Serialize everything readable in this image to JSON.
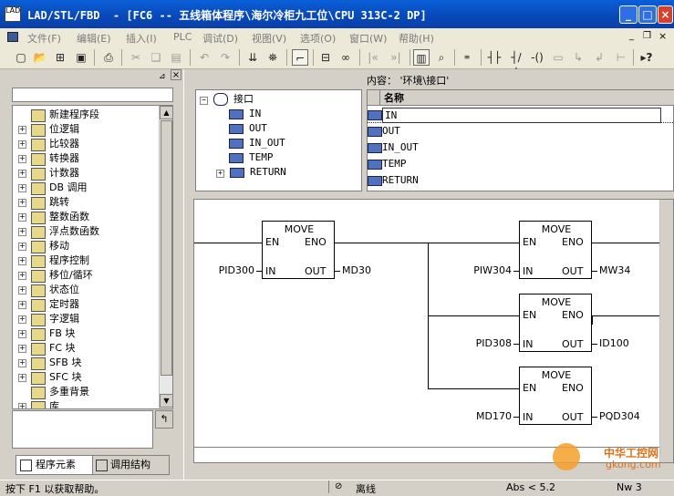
{
  "window": {
    "app_icon": "LAD",
    "title": "LAD/STL/FBD  - [FC6 -- 五线箱体程序\\海尔冷柜九工位\\CPU 313C-2 DP]",
    "buttons": [
      "minimize",
      "maximize",
      "close"
    ]
  },
  "menu": [
    "文件(F)",
    "编辑(E)",
    "插入(I)",
    "PLC",
    "调试(D)",
    "视图(V)",
    "选项(O)",
    "窗口(W)",
    "帮助(H)"
  ],
  "toolbar_icons": [
    "new-icon",
    "open-icon",
    "network-icon",
    "save-icon",
    "print-icon",
    "cut-icon",
    "copy-icon",
    "paste-icon",
    "undo-icon",
    "redo-icon",
    "download-icon",
    "monitor-icon",
    "overview-icon",
    "tree-icon",
    "glasses-icon",
    "jump-icon",
    "contact-no-icon",
    "contact-nc-icon",
    "coil-icon",
    "box-icon",
    "branch-open-icon",
    "branch-close-icon",
    "help-icon"
  ],
  "left_panel": {
    "tree": [
      {
        "label": "新建程序段",
        "icon": "new-network-icon",
        "expandable": false
      },
      {
        "label": "位逻辑",
        "icon": "bit-logic-icon",
        "expandable": true
      },
      {
        "label": "比较器",
        "icon": "comparator-icon",
        "expandable": true
      },
      {
        "label": "转换器",
        "icon": "converter-icon",
        "expandable": true
      },
      {
        "label": "计数器",
        "icon": "counter-icon",
        "expandable": true
      },
      {
        "label": "DB 调用",
        "icon": "db-call-icon",
        "expandable": true
      },
      {
        "label": "跳转",
        "icon": "jump-icon",
        "expandable": true
      },
      {
        "label": "整数函数",
        "icon": "integer-icon",
        "expandable": true
      },
      {
        "label": "浮点数函数",
        "icon": "float-icon",
        "expandable": true
      },
      {
        "label": "移动",
        "icon": "move-icon",
        "expandable": true
      },
      {
        "label": "程序控制",
        "icon": "program-control-icon",
        "expandable": true
      },
      {
        "label": "移位/循环",
        "icon": "shift-rotate-icon",
        "expandable": true
      },
      {
        "label": "状态位",
        "icon": "status-bit-icon",
        "expandable": true
      },
      {
        "label": "定时器",
        "icon": "timer-icon",
        "expandable": true
      },
      {
        "label": "字逻辑",
        "icon": "word-logic-icon",
        "expandable": true
      },
      {
        "label": "FB 块",
        "icon": "fb-block-icon",
        "expandable": true
      },
      {
        "label": "FC 块",
        "icon": "fc-block-icon",
        "expandable": true
      },
      {
        "label": "SFB 块",
        "icon": "sfb-block-icon",
        "expandable": true
      },
      {
        "label": "SFC 块",
        "icon": "sfc-block-icon",
        "expandable": true
      },
      {
        "label": "多重背景",
        "icon": "multi-instance-icon",
        "expandable": false
      },
      {
        "label": "库",
        "icon": "library-icon",
        "expandable": true
      }
    ],
    "tabs": [
      "程序元素",
      "调用结构"
    ]
  },
  "interface": {
    "root": "接口",
    "items": [
      "IN",
      "OUT",
      "IN_OUT",
      "TEMP",
      "RETURN"
    ],
    "content_label": "内容：  '环境\\接口'",
    "column_header": "名称",
    "rows": [
      "IN",
      "OUT",
      "IN_OUT",
      "TEMP",
      "RETURN"
    ]
  },
  "ladder": {
    "blocks": [
      {
        "title": "MOVE",
        "en": "EN",
        "eno": "ENO",
        "in": "IN",
        "out": "OUT",
        "in_operand": "PID300",
        "out_operand": "MD30"
      },
      {
        "title": "MOVE",
        "en": "EN",
        "eno": "ENO",
        "in": "IN",
        "out": "OUT",
        "in_operand": "PIW304",
        "out_operand": "MW34"
      },
      {
        "title": "MOVE",
        "en": "EN",
        "eno": "ENO",
        "in": "IN",
        "out": "OUT",
        "in_operand": "PID308",
        "out_operand": "ID100"
      },
      {
        "title": "MOVE",
        "en": "EN",
        "eno": "ENO",
        "in": "IN",
        "out": "OUT",
        "in_operand": "MD170",
        "out_operand": "PQD304"
      }
    ]
  },
  "status": {
    "help": "按下 F1 以获取帮助。",
    "mode": "离线",
    "abs": "Abs < 5.2",
    "nw": "Nw 3"
  },
  "watermark": {
    "text": "中华工控网",
    "url": "gkong.com"
  }
}
